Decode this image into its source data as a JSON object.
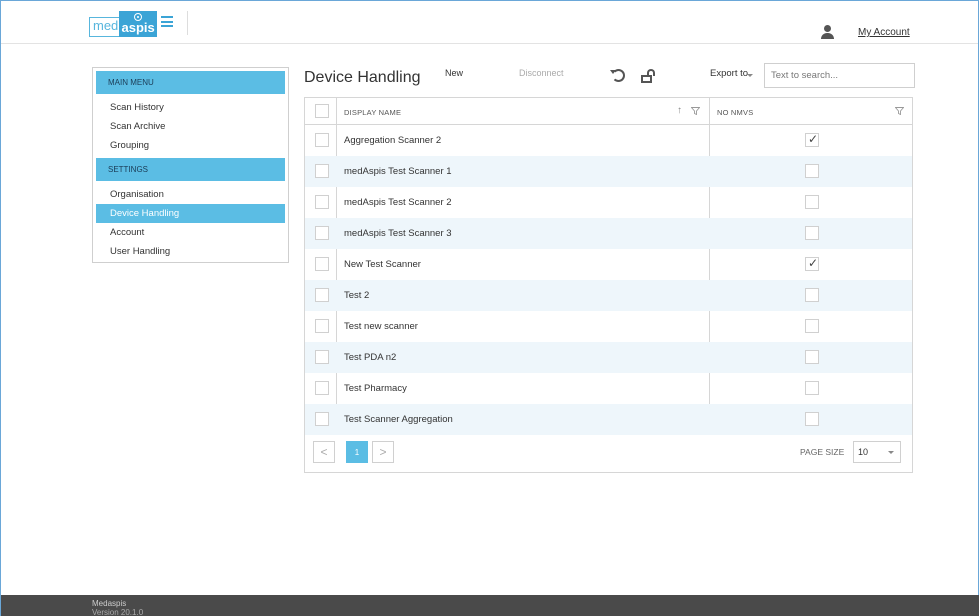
{
  "header": {
    "logo_part1": "med",
    "logo_part2": "aspis",
    "account_label": "My Account"
  },
  "sidebar": {
    "sections": [
      {
        "title": "MAIN MENU",
        "items": [
          {
            "label": "Scan History",
            "active": false
          },
          {
            "label": "Scan Archive",
            "active": false
          },
          {
            "label": "Grouping",
            "active": false
          }
        ]
      },
      {
        "title": "SETTINGS",
        "items": [
          {
            "label": "Organisation",
            "active": false
          },
          {
            "label": "Device Handling",
            "active": true
          },
          {
            "label": "Account",
            "active": false
          },
          {
            "label": "User Handling",
            "active": false
          }
        ]
      }
    ]
  },
  "toolbar": {
    "page_title": "Device Handling",
    "new_label": "New",
    "disconnect_label": "Disconnect",
    "export_label": "Export to",
    "search_placeholder": "Text to search..."
  },
  "grid": {
    "columns": [
      "DISPLAY NAME",
      "NO NMVS"
    ],
    "rows": [
      {
        "name": "Aggregation Scanner 2",
        "no_nmvs": true
      },
      {
        "name": "medAspis Test Scanner 1",
        "no_nmvs": false
      },
      {
        "name": "medAspis Test Scanner 2",
        "no_nmvs": false
      },
      {
        "name": "medAspis Test Scanner 3",
        "no_nmvs": false
      },
      {
        "name": "New Test Scanner",
        "no_nmvs": true
      },
      {
        "name": "Test 2",
        "no_nmvs": false
      },
      {
        "name": "Test new scanner",
        "no_nmvs": false
      },
      {
        "name": "Test PDA n2",
        "no_nmvs": false
      },
      {
        "name": "Test Pharmacy",
        "no_nmvs": false
      },
      {
        "name": "Test Scanner Aggregation",
        "no_nmvs": false
      }
    ]
  },
  "pager": {
    "prev": "<",
    "current_page": "1",
    "next": ">",
    "page_size_label": "PAGE SIZE",
    "page_size_value": "10"
  },
  "footer": {
    "app_name": "Medaspis",
    "version": "Version 20.1.0"
  },
  "colors": {
    "accent": "#5bbde4",
    "row_alt": "#eef6fb",
    "footer_bg": "#4a4a4a"
  }
}
